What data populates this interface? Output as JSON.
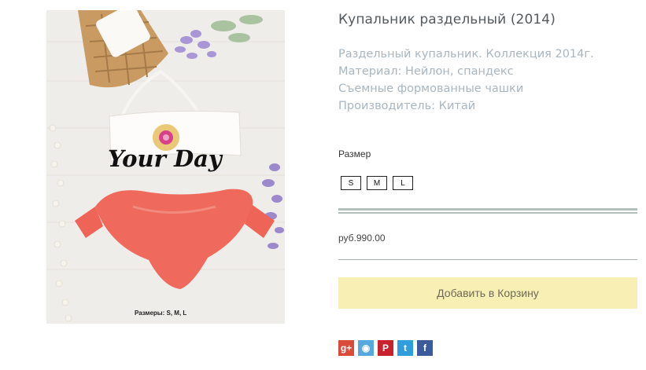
{
  "product": {
    "title": "Купальник раздельный (2014)",
    "description": [
      "Раздельный купальник. Коллекция 2014г."
    ],
    "details": [
      "Материал: Нейлон, спандекс",
      "Съемные формованные чашки",
      "Производитель: Китай"
    ],
    "image": {
      "brand_text": "Your Day",
      "sizes_caption": "Размеры: S, M, L"
    }
  },
  "options": {
    "size_label": "Размер",
    "sizes": [
      "S",
      "M",
      "L"
    ]
  },
  "price": "руб.990.00",
  "cart": {
    "add_label": "Добавить в Корзину"
  },
  "social": [
    {
      "icon": "google-plus-icon",
      "glyph": "g+",
      "color": "#d94b3a"
    },
    {
      "icon": "bookmark-icon",
      "glyph": "◉",
      "color": "#57a8de"
    },
    {
      "icon": "pinterest-icon",
      "glyph": "P",
      "color": "#c8232c"
    },
    {
      "icon": "twitter-icon",
      "glyph": "t",
      "color": "#2e9fdc"
    },
    {
      "icon": "facebook-icon",
      "glyph": "f",
      "color": "#3b5b9c"
    }
  ]
}
